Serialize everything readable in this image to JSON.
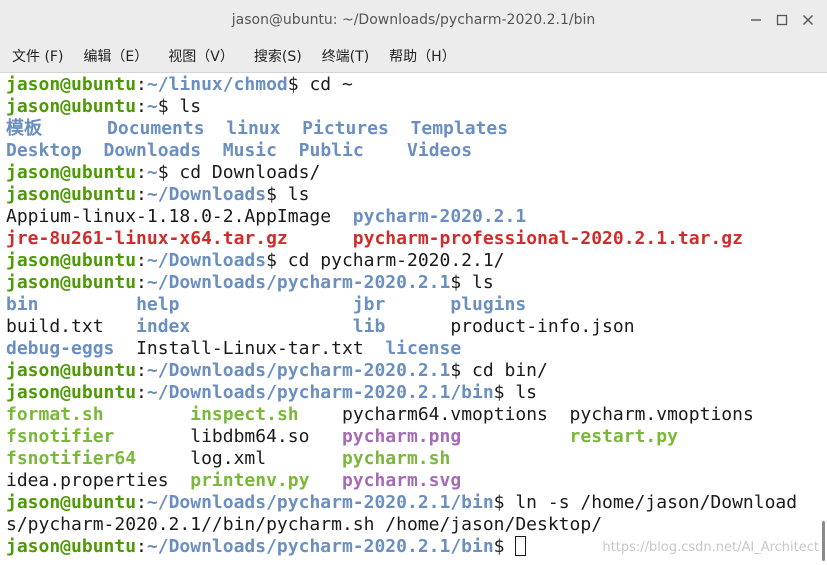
{
  "window": {
    "title": "jason@ubuntu: ~/Downloads/pycharm-2020.2.1/bin",
    "controls": [
      "minimize",
      "maximize",
      "close"
    ]
  },
  "menu": {
    "items": [
      "文件 (F)",
      "编辑（E）",
      "视图（V）",
      "搜索(S)",
      "终端(T)",
      "帮助（H）"
    ]
  },
  "colors": {
    "user": "#4e9a06",
    "path": "#6a8fc0",
    "exec": "#7ab83a",
    "image": "#a56cb5",
    "archive": "#d02c2c",
    "text": "#1a1a1a"
  },
  "terminal": {
    "lines": [
      [
        [
          "jason@ubuntu",
          "user"
        ],
        [
          ":",
          "plain"
        ],
        [
          "~/linux/chmod",
          "path"
        ],
        [
          "$ cd ~",
          "plain"
        ]
      ],
      [
        [
          "jason@ubuntu",
          "user"
        ],
        [
          ":",
          "plain"
        ],
        [
          "~",
          "path"
        ],
        [
          "$ ls",
          "plain"
        ]
      ],
      [
        [
          "模板",
          "dir"
        ],
        [
          "      ",
          "plain"
        ],
        [
          "Documents",
          "dir"
        ],
        [
          "  ",
          "plain"
        ],
        [
          "linux",
          "dir"
        ],
        [
          "  ",
          "plain"
        ],
        [
          "Pictures",
          "dir"
        ],
        [
          "  ",
          "plain"
        ],
        [
          "Templates",
          "dir"
        ]
      ],
      [
        [
          "Desktop",
          "dir"
        ],
        [
          "  ",
          "plain"
        ],
        [
          "Downloads",
          "dir"
        ],
        [
          "  ",
          "plain"
        ],
        [
          "Music",
          "dir"
        ],
        [
          "  ",
          "plain"
        ],
        [
          "Public",
          "dir"
        ],
        [
          "    ",
          "plain"
        ],
        [
          "Videos",
          "dir"
        ]
      ],
      [
        [
          "jason@ubuntu",
          "user"
        ],
        [
          ":",
          "plain"
        ],
        [
          "~",
          "path"
        ],
        [
          "$ cd Downloads/",
          "plain"
        ]
      ],
      [
        [
          "jason@ubuntu",
          "user"
        ],
        [
          ":",
          "plain"
        ],
        [
          "~/Downloads",
          "path"
        ],
        [
          "$ ls",
          "plain"
        ]
      ],
      [
        [
          "Appium-linux-1.18.0-2.AppImage  ",
          "plain"
        ],
        [
          "pycharm-2020.2.1",
          "dir"
        ]
      ],
      [
        [
          "jre-8u261-linux-x64.tar.gz",
          "arch"
        ],
        [
          "      ",
          "plain"
        ],
        [
          "pycharm-professional-2020.2.1.tar.gz",
          "arch"
        ]
      ],
      [
        [
          "jason@ubuntu",
          "user"
        ],
        [
          ":",
          "plain"
        ],
        [
          "~/Downloads",
          "path"
        ],
        [
          "$ cd pycharm-2020.2.1/",
          "plain"
        ]
      ],
      [
        [
          "jason@ubuntu",
          "user"
        ],
        [
          ":",
          "plain"
        ],
        [
          "~/Downloads/pycharm-2020.2.1",
          "path"
        ],
        [
          "$ ls",
          "plain"
        ]
      ],
      [
        [
          "bin",
          "dir"
        ],
        [
          "         ",
          "plain"
        ],
        [
          "help",
          "dir"
        ],
        [
          "                ",
          "plain"
        ],
        [
          "jbr",
          "dir"
        ],
        [
          "      ",
          "plain"
        ],
        [
          "plugins",
          "dir"
        ]
      ],
      [
        [
          "build.txt   ",
          "plain"
        ],
        [
          "index",
          "dir"
        ],
        [
          "               ",
          "plain"
        ],
        [
          "lib",
          "dir"
        ],
        [
          "      ",
          "plain"
        ],
        [
          "product-info.json",
          "plain"
        ]
      ],
      [
        [
          "debug-eggs",
          "dir"
        ],
        [
          "  ",
          "plain"
        ],
        [
          "Install-Linux-tar.txt  ",
          "plain"
        ],
        [
          "license",
          "dir"
        ]
      ],
      [
        [
          "jason@ubuntu",
          "user"
        ],
        [
          ":",
          "plain"
        ],
        [
          "~/Downloads/pycharm-2020.2.1",
          "path"
        ],
        [
          "$ cd bin/",
          "plain"
        ]
      ],
      [
        [
          "jason@ubuntu",
          "user"
        ],
        [
          ":",
          "plain"
        ],
        [
          "~/Downloads/pycharm-2020.2.1/bin",
          "path"
        ],
        [
          "$ ls",
          "plain"
        ]
      ],
      [
        [
          "format.sh",
          "exec"
        ],
        [
          "        ",
          "plain"
        ],
        [
          "inspect.sh",
          "exec"
        ],
        [
          "    ",
          "plain"
        ],
        [
          "pycharm64.vmoptions  pycharm.vmoptions",
          "plain"
        ]
      ],
      [
        [
          "fsnotifier",
          "exec"
        ],
        [
          "       ",
          "plain"
        ],
        [
          "libdbm64.so   ",
          "plain"
        ],
        [
          "pycharm.png",
          "img"
        ],
        [
          "          ",
          "plain"
        ],
        [
          "restart.py",
          "exec"
        ]
      ],
      [
        [
          "fsnotifier64",
          "exec"
        ],
        [
          "     ",
          "plain"
        ],
        [
          "log.xml       ",
          "plain"
        ],
        [
          "pycharm.sh",
          "exec"
        ]
      ],
      [
        [
          "idea.properties  ",
          "plain"
        ],
        [
          "printenv.py",
          "exec"
        ],
        [
          "   ",
          "plain"
        ],
        [
          "pycharm.svg",
          "img"
        ]
      ],
      [
        [
          "jason@ubuntu",
          "user"
        ],
        [
          ":",
          "plain"
        ],
        [
          "~/Downloads/pycharm-2020.2.1/bin",
          "path"
        ],
        [
          "$ ln -s /home/jason/Download",
          "plain"
        ]
      ],
      [
        [
          "s/pycharm-2020.2.1//bin/pycharm.sh /home/jason/Desktop/",
          "plain"
        ]
      ],
      [
        [
          "jason@ubuntu",
          "user"
        ],
        [
          ":",
          "plain"
        ],
        [
          "~/Downloads/pycharm-2020.2.1/bin",
          "path"
        ],
        [
          "$ ",
          "plain"
        ]
      ]
    ]
  },
  "watermark": "https://blog.csdn.net/AI_Architect"
}
